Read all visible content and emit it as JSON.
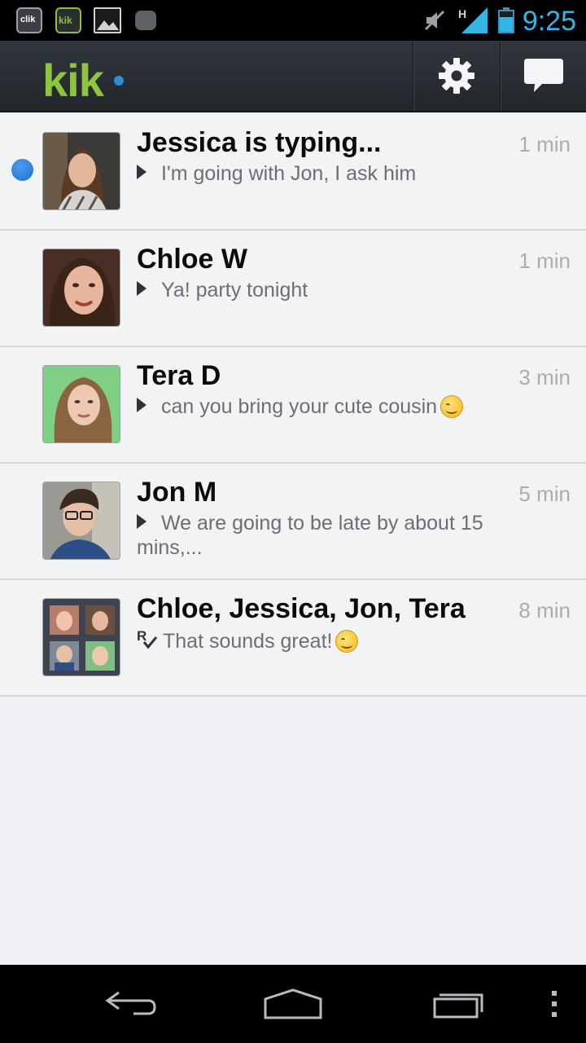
{
  "status_bar": {
    "time": "9:25",
    "notification_clik_label": "clik",
    "notification_kik_label": "kik",
    "network_type": "H",
    "colors": {
      "clock": "#33b5e5",
      "signal": "#33b5e5"
    }
  },
  "action_bar": {
    "logo_text": "kik",
    "settings_icon": "gear-icon",
    "new_chat_icon": "chat-bubble-icon",
    "colors": {
      "logo": "#8cc63e",
      "logo_dot": "#2e8bd8",
      "background": "#2b2f35"
    }
  },
  "conversations": [
    {
      "name": "Jessica is typing...",
      "time": "1 min",
      "preview": "I'm going with Jon, I ask him",
      "unread": true,
      "status_icon": "sent-arrow-icon",
      "emoji": false
    },
    {
      "name": "Chloe W",
      "time": "1 min",
      "preview": "Ya! party tonight",
      "unread": false,
      "status_icon": "sent-arrow-icon",
      "emoji": false
    },
    {
      "name": "Tera D",
      "time": "3 min",
      "preview": "can you bring your cute cousin",
      "unread": false,
      "status_icon": "sent-arrow-icon",
      "emoji": true
    },
    {
      "name": "Jon M",
      "time": "5 min",
      "preview": "We are going to be late by about 15 mins,...",
      "unread": false,
      "status_icon": "sent-arrow-icon",
      "emoji": false
    },
    {
      "name": "Chloe, Jessica, Jon, Tera",
      "time": "8 min",
      "preview": "That sounds great!",
      "unread": false,
      "status_icon": "read-receipt-icon",
      "emoji": true
    }
  ],
  "nav_bar": {
    "back_icon": "back-arrow-icon",
    "home_icon": "home-icon",
    "recents_icon": "recent-apps-icon",
    "menu_icon": "overflow-menu-icon"
  }
}
